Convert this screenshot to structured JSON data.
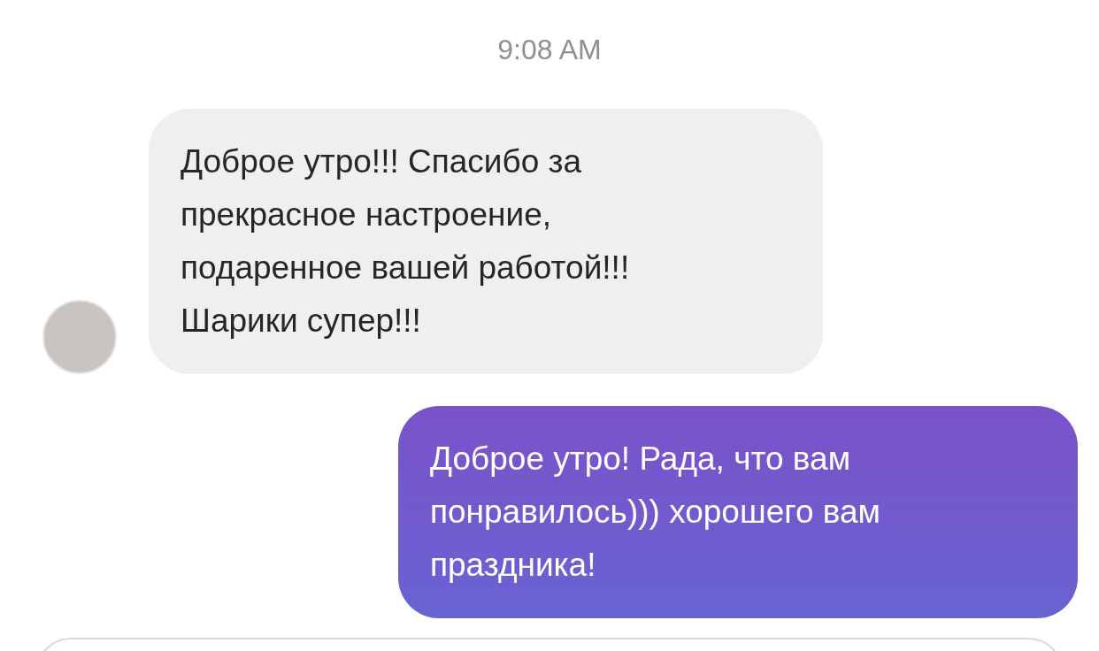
{
  "timestamp": "9:08 AM",
  "messages": [
    {
      "kind": "incoming",
      "text": "Доброе утро!!! Спасибо за\nпрекрасное настроение,\nподаренное вашей работой!!!\nШарики супер!!!"
    },
    {
      "kind": "outgoing",
      "text": "Доброе утро! Рада, что вам\nпонравилось))) хорошего вам\nпраздника!"
    }
  ]
}
